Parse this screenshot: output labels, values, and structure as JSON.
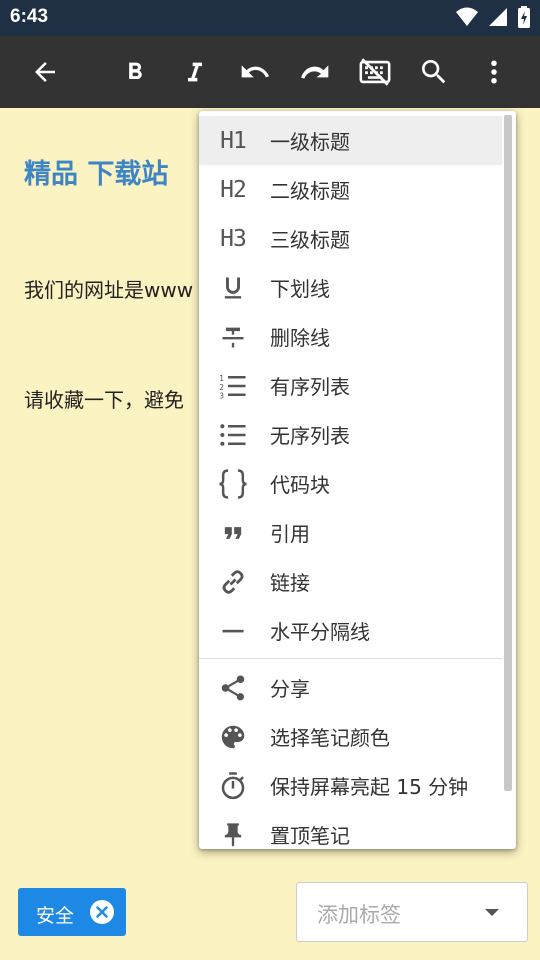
{
  "status_bar": {
    "time": "6:43"
  },
  "toolbar": {
    "icons": [
      "back-arrow-icon",
      "bold-icon",
      "italic-icon",
      "undo-icon",
      "redo-icon",
      "keyboard-hide-icon",
      "search-icon",
      "more-vert-icon"
    ]
  },
  "note": {
    "title": "精品 下载站",
    "line1": "我们的网址是www",
    "line2": "请收藏一下，避免"
  },
  "menu": {
    "items": [
      {
        "label": "一级标题",
        "icon": "H1"
      },
      {
        "label": "二级标题",
        "icon": "H2"
      },
      {
        "label": "三级标题",
        "icon": "H3"
      },
      {
        "label": "下划线",
        "icon": "underline-icon"
      },
      {
        "label": "删除线",
        "icon": "strikethrough-icon"
      },
      {
        "label": "有序列表",
        "icon": "ordered-list-icon"
      },
      {
        "label": "无序列表",
        "icon": "unordered-list-icon"
      },
      {
        "label": "代码块",
        "icon": "code-block-icon"
      },
      {
        "label": "引用",
        "icon": "quote-icon"
      },
      {
        "label": "链接",
        "icon": "link-icon"
      },
      {
        "label": "水平分隔线",
        "icon": "horizontal-rule-icon"
      },
      {
        "label": "分享",
        "icon": "share-icon"
      },
      {
        "label": "选择笔记颜色",
        "icon": "palette-icon"
      },
      {
        "label": "保持屏幕亮起 15 分钟",
        "icon": "timer-icon"
      },
      {
        "label": "置顶笔记",
        "icon": "pin-icon"
      }
    ]
  },
  "bottom": {
    "tag_label": "安全",
    "tag_placeholder": "添加标签"
  },
  "colors": {
    "status_bar": "#1f2f44",
    "toolbar": "#333333",
    "note_bg": "#fcf3c3",
    "title": "#3d85c4",
    "chip": "#1e88e5"
  }
}
